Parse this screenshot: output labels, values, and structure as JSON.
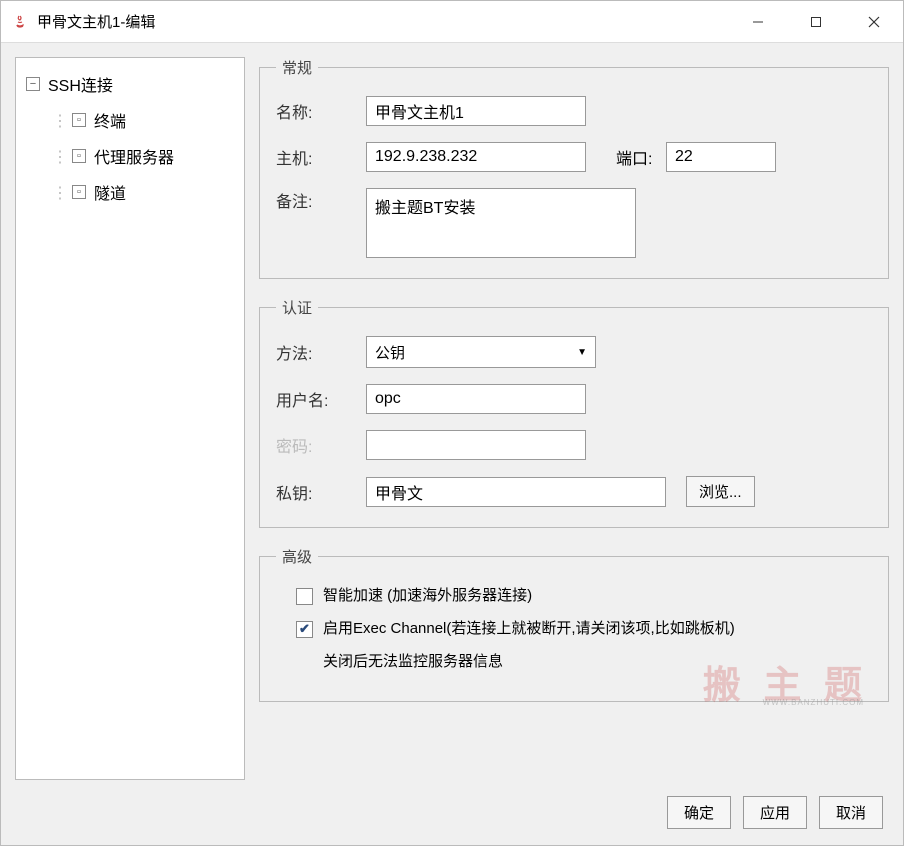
{
  "window": {
    "title": "甲骨文主机1-编辑"
  },
  "sidebar": {
    "root": "SSH连接",
    "items": [
      "终端",
      "代理服务器",
      "隧道"
    ]
  },
  "general": {
    "legend": "常规",
    "name_label": "名称:",
    "name_value": "甲骨文主机1",
    "host_label": "主机:",
    "host_value": "192.9.238.232",
    "port_label": "端口:",
    "port_value": "22",
    "remark_label": "备注:",
    "remark_value": "搬主题BT安装"
  },
  "auth": {
    "legend": "认证",
    "method_label": "方法:",
    "method_value": "公钥",
    "user_label": "用户名:",
    "user_value": "opc",
    "pass_label": "密码:",
    "pass_value": "",
    "key_label": "私钥:",
    "key_value": "甲骨文",
    "browse_label": "浏览..."
  },
  "advanced": {
    "legend": "高级",
    "accel_label": "智能加速 (加速海外服务器连接)",
    "exec_label": "启用Exec Channel(若连接上就被断开,请关闭该项,比如跳板机)",
    "exec_note": "关闭后无法监控服务器信息"
  },
  "footer": {
    "ok": "确定",
    "apply": "应用",
    "cancel": "取消"
  },
  "watermark": {
    "main": "搬 主 题",
    "sub": "WWW.BANZHUTI.COM"
  }
}
